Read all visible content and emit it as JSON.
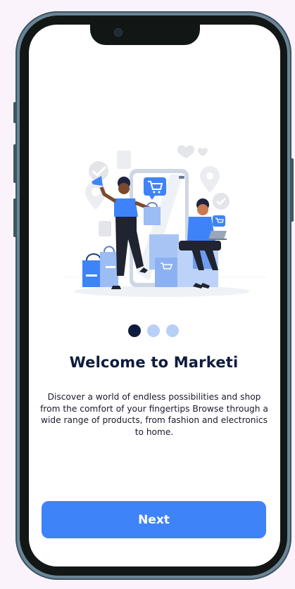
{
  "onboarding": {
    "title": "Welcome to Marketi",
    "description": "Discover a world of endless possibilities and shop from the comfort of your fingertips Browse through a wide range of products, from fashion and electronics to home.",
    "next_label": "Next",
    "pagination": {
      "total": 3,
      "active": 1
    }
  },
  "colors": {
    "primary": "#3f83f8",
    "title": "#0e1b3d",
    "dot_inactive": "#b9d0f6",
    "dot_active": "#0d1b3e"
  },
  "illustration": {
    "icon": "shopping-illustration"
  }
}
